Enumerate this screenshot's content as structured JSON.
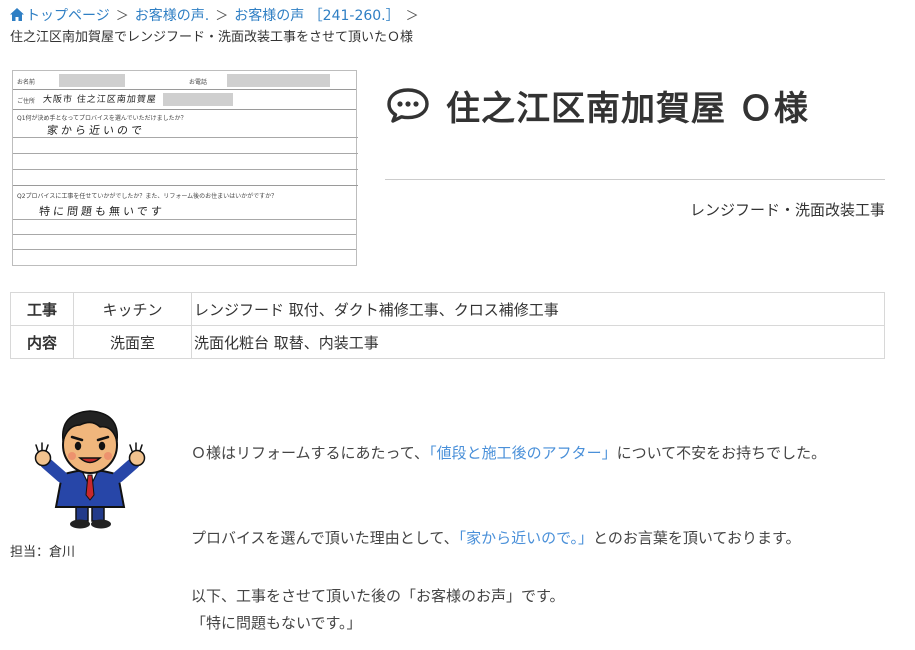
{
  "breadcrumb": {
    "items": [
      "トップページ",
      "お客様の声.",
      "お客様の声 ［241-260.］"
    ],
    "separator": "＞",
    "current": "住之江区南加賀屋でレンジフード・洗面改装工事をさせて頂いたＯ様"
  },
  "survey_scan": {
    "name_label": "お名前",
    "phone_label": "お電話",
    "address_label": "ご住所",
    "address_hand": "大阪市 住之江区南加賀屋",
    "q1_label": "Q1何が決め手となってプロバイスを選んでいただけましたか？",
    "q1_hand": "家から近いので",
    "q2_label": "Q2プロバイスに工事を任せていかがでしたか？また、リフォーム後のお住まいはいかがですか？",
    "q2_hand": "特に問題も無いです"
  },
  "title": "住之江区南加賀屋 Ｏ様",
  "subtitle": "レンジフード・洗面改装工事",
  "work_table": {
    "header_line1": "工事",
    "header_line2": "内容",
    "rows": [
      {
        "category": "キッチン",
        "detail": "レンジフード 取付、ダクト補修工事、クロス補修工事"
      },
      {
        "category": "洗面室",
        "detail": "洗面化粧台 取替、内装工事"
      }
    ]
  },
  "staff": {
    "label": "担当：倉川"
  },
  "message": {
    "p1_before": "Ｏ様はリフォームするにあたって、",
    "p1_highlight": "「値段と施工後のアフター」",
    "p1_after": "について不安をお持ちでした。",
    "p2_before": "プロバイスを選んで頂いた理由として、",
    "p2_highlight": "「家から近いので。」",
    "p2_after": "とのお言葉を頂いております。",
    "p3": "以下、工事をさせて頂いた後の「お客様のお声」です。",
    "p4_highlight": "「特に問題もないです。」"
  },
  "colors": {
    "link": "#2f7fc4",
    "highlight": "#4a90d9",
    "text": "#333333",
    "border": "#d8d8d8"
  },
  "icons": {
    "home": "home-icon",
    "title": "speech-bubble-icon"
  }
}
